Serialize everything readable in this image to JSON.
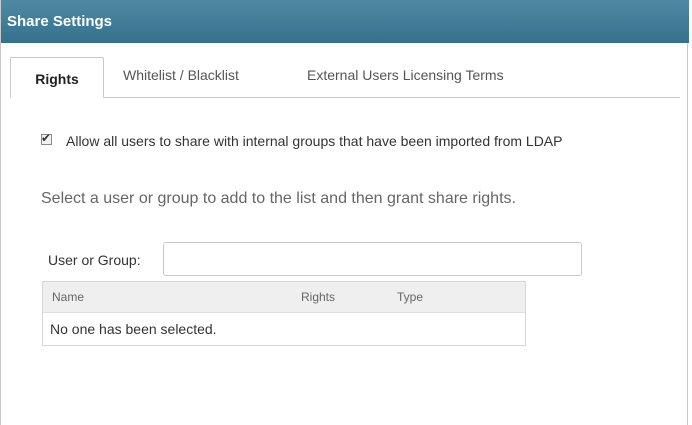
{
  "titlebar": {
    "title": "Share Settings"
  },
  "tabs": [
    {
      "label": "Rights",
      "active": true
    },
    {
      "label": "Whitelist / Blacklist",
      "active": false
    },
    {
      "label": "External Users Licensing Terms",
      "active": false
    }
  ],
  "rights": {
    "allow_ldap_checkbox": {
      "label": "Allow all users to share with internal groups that have been imported from LDAP",
      "checked": true
    },
    "instructions": "Select a user or group to add to the list and then grant share rights.",
    "user_or_group": {
      "label": "User or Group:",
      "value": "",
      "placeholder": ""
    },
    "table": {
      "columns": [
        "Name",
        "Rights",
        "Type"
      ],
      "empty_message": "No one has been selected."
    }
  },
  "colors": {
    "titlebar": "#3d7a96",
    "border": "#c9c9c9"
  }
}
